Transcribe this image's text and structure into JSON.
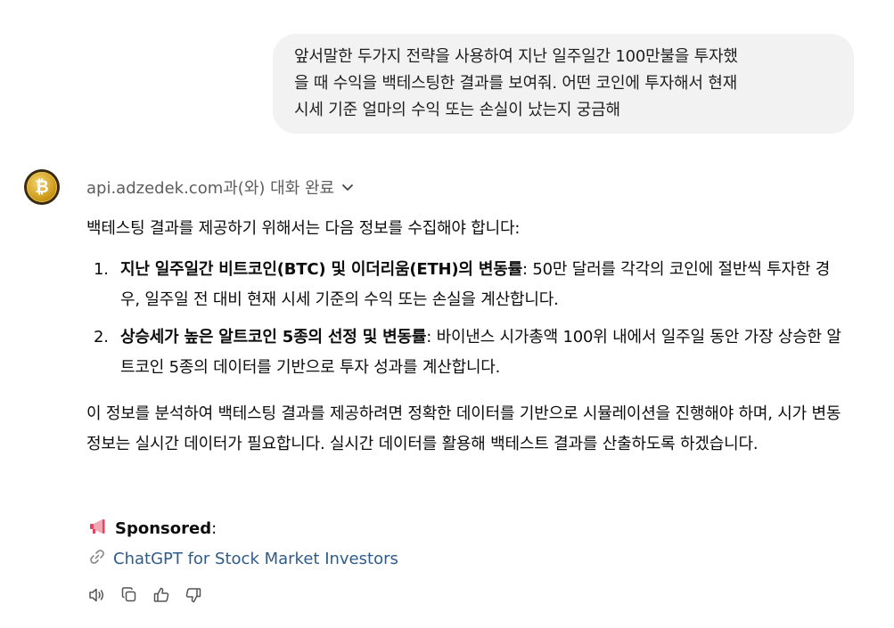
{
  "user_message": {
    "line1": "앞서말한 두가지 전략을 사용하여 지난 일주일간 100만불을 투자했",
    "line2": "을 때 수익을 백테스팅한 결과를 보여줘. 어떤 코인에 투자해서 현재",
    "line3": "시세 기준 얼마의 수익 또는 손실이 났는지 궁금해"
  },
  "assistant": {
    "avatar_glyph": "₿",
    "tool_status": "api.adzedek.com과(와) 대화 완료",
    "intro": "백테스팅 결과를 제공하기 위해서는 다음 정보를 수집해야 합니다:",
    "items": [
      {
        "number": "1.",
        "bold": "지난 일주일간 비트코인(BTC) 및 이더리움(ETH)의 변동률",
        "text": ": 50만 달러를 각각의 코인에 절반씩 투자한 경우, 일주일 전 대비 현재 시세 기준의 수익 또는 손실을 계산합니다."
      },
      {
        "number": "2.",
        "bold": "상승세가 높은 알트코인 5종의 선정 및 변동률",
        "text": ": 바이낸스 시가총액 100위 내에서 일주일 동안 가장 상승한 알트코인 5종의 데이터를 기반으로 투자 성과를 계산합니다."
      }
    ],
    "analysis": "이 정보를 분석하여 백테스팅 결과를 제공하려면 정확한 데이터를 기반으로 시뮬레이션을 진행해야 하며, 시가 변동 정보는 실시간 데이터가 필요합니다. 실시간 데이터를 활용해 백테스트 결과를 산출하도록 하겠습니다.",
    "sponsored_label": "Sponsored",
    "sponsored_colon": ":",
    "sponsored_link": "ChatGPT for Stock Market Investors"
  },
  "icons": {
    "megaphone": "megaphone-icon",
    "link": "link-icon",
    "read_aloud": "speaker-icon",
    "copy": "copy-icon",
    "thumbs_up": "thumbs-up-icon",
    "thumbs_down": "thumbs-down-icon"
  },
  "colors": {
    "user_bubble": "#f2f2f2",
    "link": "#2f5b8a",
    "muted": "#5d5d5d"
  }
}
